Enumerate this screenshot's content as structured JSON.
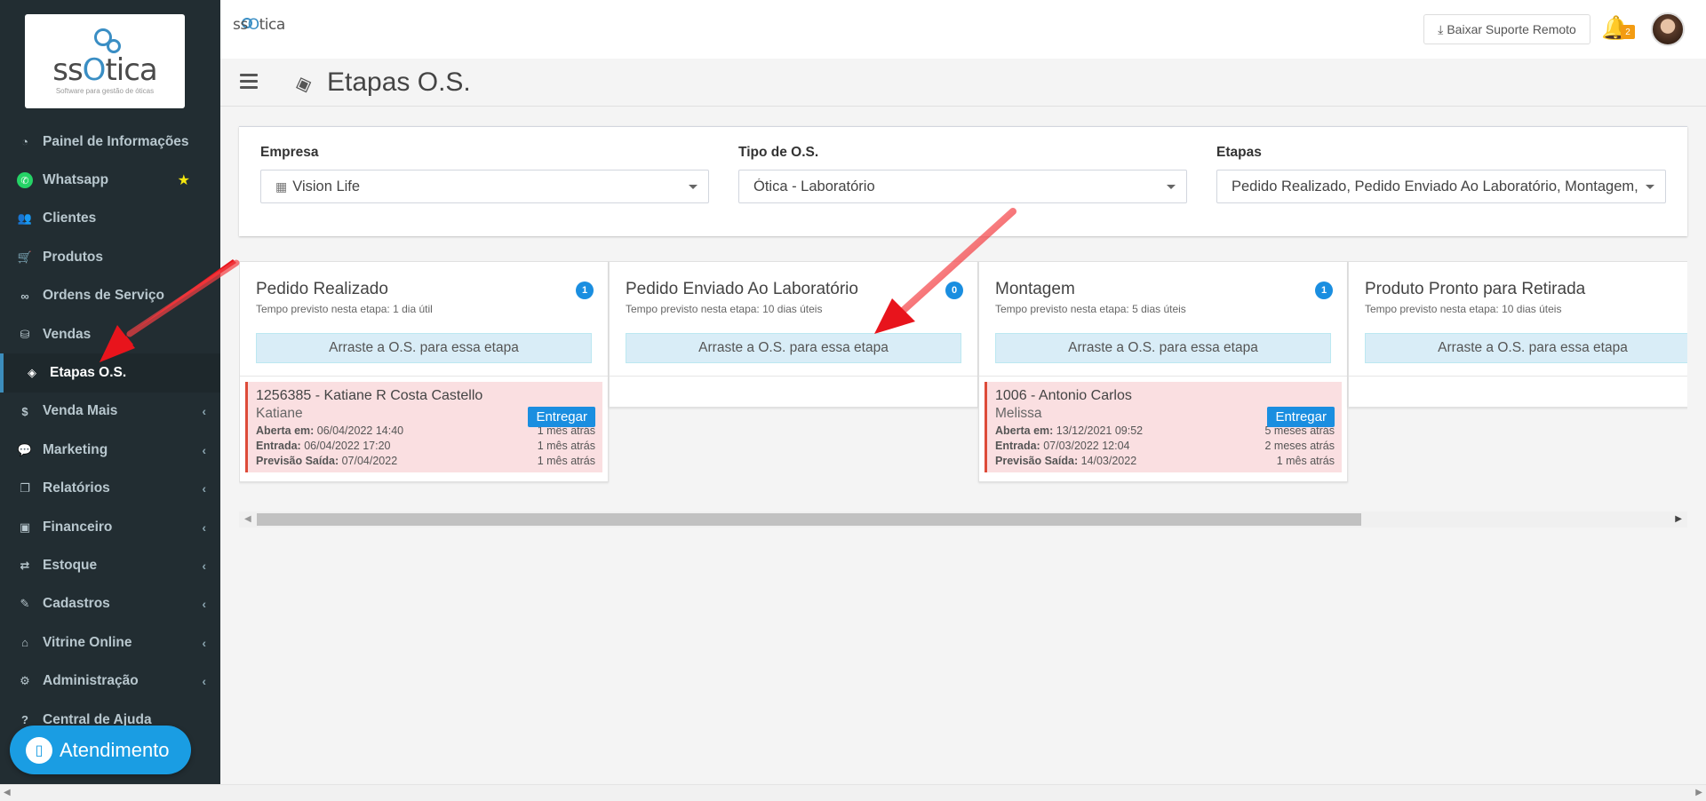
{
  "sidebar": {
    "logo": {
      "brand_pre": "ss",
      "brand_o": "O",
      "brand_post": "tica",
      "tagline": "Software para gestão de óticas"
    },
    "items": [
      {
        "label": "Painel de Informações",
        "icon": "dashboard-icon"
      },
      {
        "label": "Whatsapp",
        "icon": "whatsapp-icon"
      },
      {
        "label": "Clientes",
        "icon": "users-icon"
      },
      {
        "label": "Produtos",
        "icon": "cart-icon"
      },
      {
        "label": "Ordens de Serviço",
        "icon": "glasses-icon"
      },
      {
        "label": "Vendas",
        "icon": "basket-icon"
      },
      {
        "label": "Etapas O.S.",
        "icon": "tag-icon"
      },
      {
        "label": "Venda Mais",
        "icon": "dollar-icon"
      },
      {
        "label": "Marketing",
        "icon": "comments-icon"
      },
      {
        "label": "Relatórios",
        "icon": "copy-icon"
      },
      {
        "label": "Financeiro",
        "icon": "money-icon"
      },
      {
        "label": "Estoque",
        "icon": "exchange-icon"
      },
      {
        "label": "Cadastros",
        "icon": "edit-icon"
      },
      {
        "label": "Vitrine Online",
        "icon": "bag-icon"
      },
      {
        "label": "Administração",
        "icon": "cogs-icon"
      },
      {
        "label": "Central de Ajuda",
        "icon": "question-icon"
      }
    ],
    "atendimento_label": "Atendimento"
  },
  "topbar": {
    "brand_pre": "ss",
    "brand_o": "O",
    "brand_post": "tica",
    "suporte_label": "Baixar Suporte Remoto",
    "notification_count": "2"
  },
  "page": {
    "title": "Etapas O.S."
  },
  "filters": {
    "empresa": {
      "label": "Empresa",
      "value": "Vision Life"
    },
    "tipo": {
      "label": "Tipo de O.S.",
      "value": "Ótica - Laboratório"
    },
    "etapas": {
      "label": "Etapas",
      "value": "Pedido Realizado, Pedido Enviado Ao Laboratório, Montagem, Produto Pronto para Retirada"
    }
  },
  "columns": [
    {
      "title": "Pedido Realizado",
      "count": "1",
      "subtitle": "Tempo previsto nesta etapa: 1 dia útil",
      "drop_label": "Arraste a O.S. para essa etapa",
      "cards": [
        {
          "title": "1256385 - Katiane R Costa Castello",
          "client": "Katiane",
          "button": "Entregar",
          "rows": [
            {
              "key": "Aberta em:",
              "val": "06/04/2022 14:40",
              "rel": "1 mês atrás"
            },
            {
              "key": "Entrada:",
              "val": "06/04/2022 17:20",
              "rel": "1 mês atrás"
            },
            {
              "key": "Previsão Saída:",
              "val": "07/04/2022",
              "rel": "1 mês atrás"
            }
          ]
        }
      ]
    },
    {
      "title": "Pedido Enviado Ao Laboratório",
      "count": "0",
      "subtitle": "Tempo previsto nesta etapa: 10 dias úteis",
      "drop_label": "Arraste a O.S. para essa etapa",
      "cards": []
    },
    {
      "title": "Montagem",
      "count": "1",
      "subtitle": "Tempo previsto nesta etapa: 5 dias úteis",
      "drop_label": "Arraste a O.S. para essa etapa",
      "cards": [
        {
          "title": "1006 - Antonio Carlos",
          "client": "Melissa",
          "button": "Entregar",
          "rows": [
            {
              "key": "Aberta em:",
              "val": "13/12/2021 09:52",
              "rel": "5 meses atrás"
            },
            {
              "key": "Entrada:",
              "val": "07/03/2022 12:04",
              "rel": "2 meses atrás"
            },
            {
              "key": "Previsão Saída:",
              "val": "14/03/2022",
              "rel": "1 mês atrás"
            }
          ]
        }
      ]
    },
    {
      "title": "Produto Pronto para Retirada",
      "count": "",
      "subtitle": "Tempo previsto nesta etapa: 10 dias úteis",
      "drop_label": "Arraste a O.S. para essa etapa",
      "cards": []
    }
  ],
  "colors": {
    "sidebar_bg": "#222d32",
    "accent": "#1a8ee0",
    "card_bg": "#fadfe1",
    "card_border": "#dd4b39",
    "arrow": "#e8141c"
  }
}
